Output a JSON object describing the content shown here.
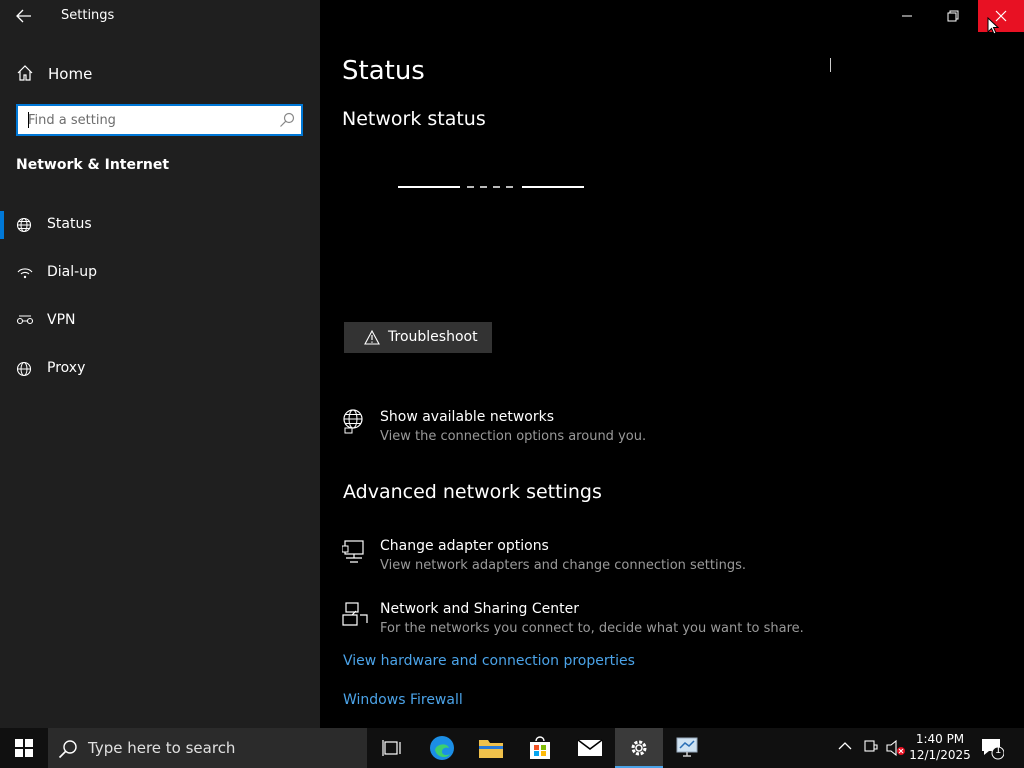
{
  "window": {
    "title": "Settings"
  },
  "sidebar": {
    "home_label": "Home",
    "search_placeholder": "Find a setting",
    "section_label": "Network & Internet",
    "items": [
      {
        "label": "Status",
        "icon": "globe-network-icon",
        "active": true
      },
      {
        "label": "Dial-up",
        "icon": "dialup-icon",
        "active": false
      },
      {
        "label": "VPN",
        "icon": "vpn-icon",
        "active": false
      },
      {
        "label": "Proxy",
        "icon": "globe-icon",
        "active": false
      }
    ]
  },
  "main": {
    "page_title": "Status",
    "network_status_title": "Network status",
    "troubleshoot_label": "Troubleshoot",
    "show_networks": {
      "title": "Show available networks",
      "desc": "View the connection options around you."
    },
    "advanced_title": "Advanced network settings",
    "change_adapter": {
      "title": "Change adapter options",
      "desc": "View network adapters and change connection settings."
    },
    "sharing_center": {
      "title": "Network and Sharing Center",
      "desc": "For the networks you connect to, decide what you want to share."
    },
    "links": [
      "View hardware and connection properties",
      "Windows Firewall"
    ]
  },
  "taskbar": {
    "search_placeholder": "Type here to search",
    "time": "1:40 PM",
    "date": "12/1/2025",
    "notification_count": "1"
  },
  "colors": {
    "accent": "#0078d7",
    "link": "#4ba3e8",
    "close_hover": "#e81123",
    "sidebar_bg": "#1f1f1f",
    "main_bg": "#000000"
  }
}
